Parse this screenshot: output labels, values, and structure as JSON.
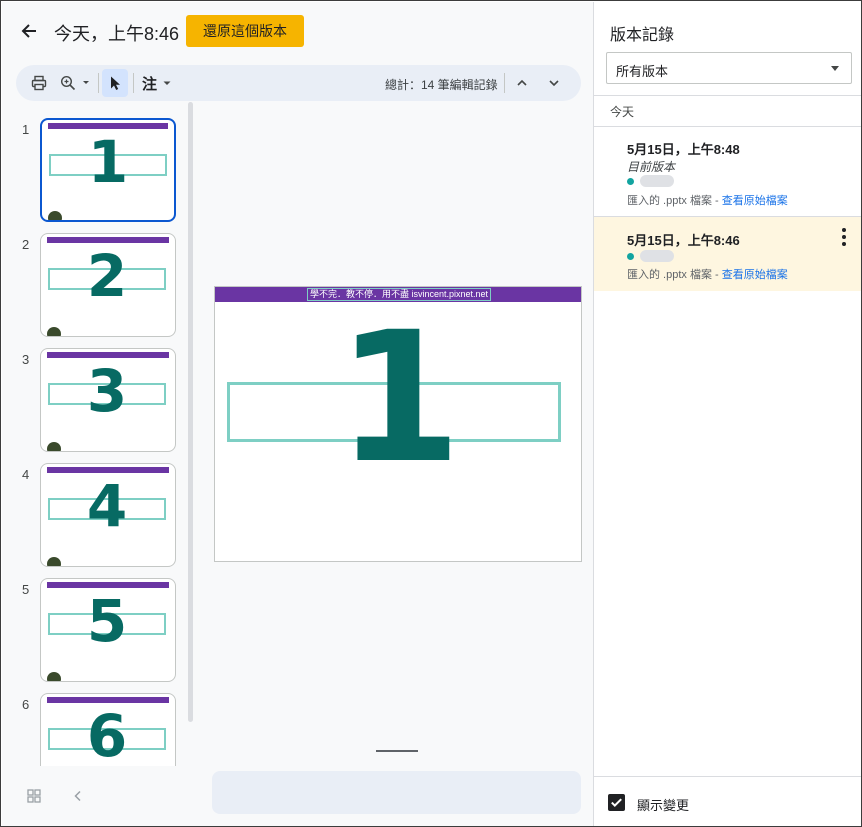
{
  "header": {
    "version_title": "今天，上午8:46",
    "restore_label": "還原這個版本"
  },
  "toolbar": {
    "mode_label": "注",
    "edit_count": "總計：14 筆編輯記錄"
  },
  "filmstrip": {
    "slides": [
      {
        "num": "1",
        "digit": "1"
      },
      {
        "num": "2",
        "digit": "2"
      },
      {
        "num": "3",
        "digit": "3"
      },
      {
        "num": "4",
        "digit": "4"
      },
      {
        "num": "5",
        "digit": "5"
      },
      {
        "num": "6",
        "digit": "6"
      }
    ]
  },
  "slide": {
    "banner": "學不完．教不停．用不盡 isvincent.pixnet.net",
    "digit": "1"
  },
  "panel": {
    "title": "版本記錄",
    "filter": "所有版本",
    "group": "今天",
    "versions": [
      {
        "date": "5月15日，上午8:48",
        "subtitle": "目前版本",
        "meta_prefix": "匯入的 .pptx 檔案 - ",
        "meta_link": "查看原始檔案"
      },
      {
        "date": "5月15日，上午8:46",
        "meta_prefix": "匯入的 .pptx 檔案 - ",
        "meta_link": "查看原始檔案"
      }
    ],
    "show_changes": "顯示變更"
  },
  "colors": {
    "restore": "#f6b400",
    "banner": "#6a35a3",
    "digit": "#076a63",
    "box": "#7ecfc4",
    "selected_version": "#fef6e0",
    "author_dot": "#12a4a0"
  }
}
